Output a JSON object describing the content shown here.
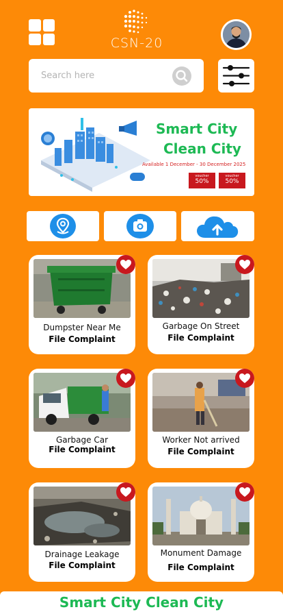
{
  "header": {
    "logo_text": "CSN-20",
    "menu_icon": "grid-menu-icon",
    "avatar_icon": "user-avatar"
  },
  "search": {
    "placeholder": "Search here",
    "icon": "search-icon",
    "filter_icon": "sliders-icon"
  },
  "banner": {
    "title_line1": "Smart City",
    "title_line2": "Clean City",
    "dates": "Available 1 December - 30 December 2025",
    "vouchers": [
      {
        "label": "voucher",
        "percent": "50%"
      },
      {
        "label": "voucher",
        "percent": "50%"
      }
    ]
  },
  "quick_actions": [
    {
      "icon": "location-pin-icon"
    },
    {
      "icon": "camera-icon"
    },
    {
      "icon": "cloud-upload-icon"
    }
  ],
  "complaints": [
    {
      "title": "Dumpster Near Me",
      "action": "File Complaint",
      "photo": "green-dumpster"
    },
    {
      "title": "Garbage On Street",
      "action": "File Complaint",
      "photo": "street-garbage"
    },
    {
      "title": "Garbage Car",
      "action": "File Complaint",
      "photo": "garbage-vehicle"
    },
    {
      "title": "Worker Not arrived",
      "action": "File Complaint",
      "photo": "street-sweeper"
    },
    {
      "title": "Drainage Leakage",
      "action": "File Complaint",
      "photo": "drainage-water"
    },
    {
      "title": "Monument Damage",
      "action": "File Complaint",
      "photo": "monument"
    }
  ],
  "footer": {
    "text": "Smart City Clean City"
  },
  "colors": {
    "background": "#FD8A07",
    "accent_green": "#1DB954",
    "accent_red": "#C8181E",
    "icon_blue": "#1E8FE8"
  }
}
